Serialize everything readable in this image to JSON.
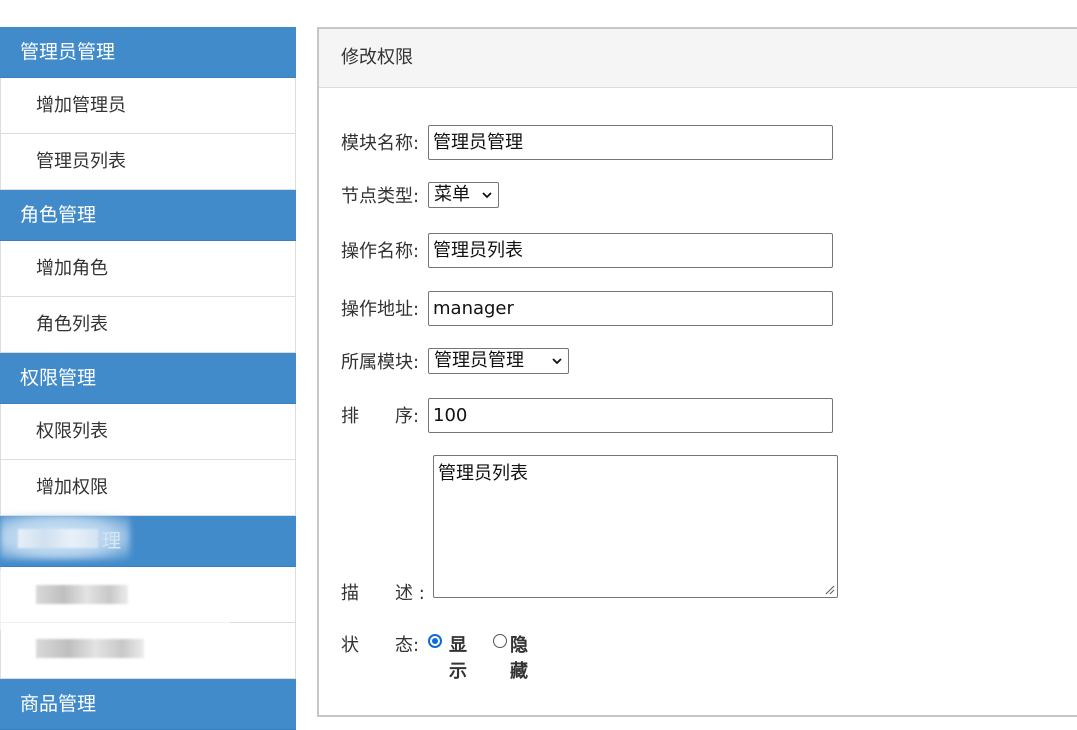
{
  "sidebar": {
    "groups": [
      {
        "title": "管理员管理",
        "items": [
          "增加管理员",
          "管理员列表"
        ]
      },
      {
        "title": "角色管理",
        "items": [
          "增加角色",
          "角色列表"
        ]
      },
      {
        "title": "权限管理",
        "items": [
          "权限列表",
          "增加权限"
        ]
      },
      {
        "title": "理",
        "items": [
          "",
          ""
        ]
      },
      {
        "title": "商品管理",
        "items": []
      }
    ]
  },
  "panel": {
    "heading": "修改权限"
  },
  "form": {
    "module_name": {
      "label": "模块名称:",
      "value": "管理员管理"
    },
    "node_type": {
      "label": "节点类型:",
      "selected": "菜单"
    },
    "action_name": {
      "label": "操作名称:",
      "value": "管理员列表"
    },
    "action_url": {
      "label": "操作地址:",
      "value": "manager"
    },
    "parent_module": {
      "label": "所属模块:",
      "selected": "管理员管理"
    },
    "sort": {
      "label": "排　　序:",
      "value": "100"
    },
    "description": {
      "label": "描　　述 :",
      "value": "管理员列表"
    },
    "status": {
      "label": "状　　态:",
      "options": [
        {
          "label": "显示",
          "checked": true
        },
        {
          "label": "隐藏",
          "checked": false
        }
      ]
    }
  },
  "colors": {
    "sidebar_header": "#428bca",
    "radio_accent": "#0b6bd8"
  }
}
